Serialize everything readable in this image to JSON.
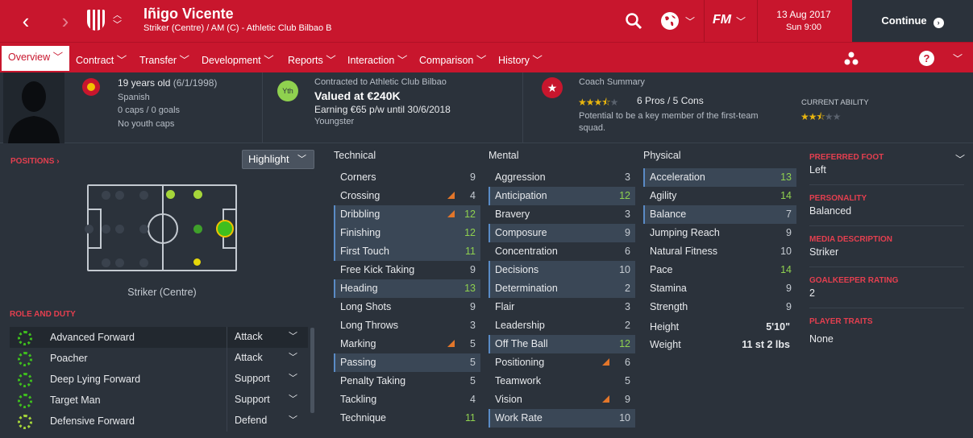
{
  "header": {
    "player_name": "Iñigo Vicente",
    "subtitle": "Striker (Centre) / AM (C) - Athletic Club Bilbao B",
    "logo": "FM",
    "date": "13 Aug 2017",
    "time": "Sun 9:00",
    "continue_label": "Continue"
  },
  "tabs": [
    "Overview",
    "Contract",
    "Transfer",
    "Development",
    "Reports",
    "Interaction",
    "Comparison",
    "History"
  ],
  "bio": {
    "age": "19 years old",
    "dob": "(6/1/1998)",
    "nationality": "Spanish",
    "caps": "0 caps / 0 goals",
    "youth_caps": "No youth caps"
  },
  "contract": {
    "badge": "Yth",
    "contracted_to": "Contracted to Athletic Club Bilbao",
    "value": "Valued at €240K",
    "earning": "Earning €65 p/w until 30/6/2018",
    "status": "Youngster"
  },
  "coach": {
    "title": "Coach Summary",
    "stars": 3.5,
    "pros_cons": "6 Pros / 5 Cons",
    "summary": "Potential to be a key member of the first-team squad.",
    "current_ability_label": "CURRENT ABILITY",
    "current_ability_stars": 2.5
  },
  "positions": {
    "label": "POSITIONS",
    "highlight_label": "Highlight",
    "position_name": "Striker (Centre)",
    "role_duty_label": "ROLE AND DUTY",
    "roles": [
      {
        "name": "Advanced Forward",
        "duty": "Attack"
      },
      {
        "name": "Poacher",
        "duty": "Attack"
      },
      {
        "name": "Deep Lying Forward",
        "duty": "Support"
      },
      {
        "name": "Target Man",
        "duty": "Support"
      },
      {
        "name": "Defensive Forward",
        "duty": "Defend"
      }
    ]
  },
  "technical": {
    "title": "Technical",
    "attrs": [
      {
        "name": "Corners",
        "value": 9
      },
      {
        "name": "Crossing",
        "value": 4,
        "trend": "down"
      },
      {
        "name": "Dribbling",
        "value": 12,
        "trend": "down",
        "highlight": true
      },
      {
        "name": "Finishing",
        "value": 12,
        "highlight": true
      },
      {
        "name": "First Touch",
        "value": 11,
        "highlight": true
      },
      {
        "name": "Free Kick Taking",
        "value": 9
      },
      {
        "name": "Heading",
        "value": 13,
        "highlight": true
      },
      {
        "name": "Long Shots",
        "value": 9
      },
      {
        "name": "Long Throws",
        "value": 3
      },
      {
        "name": "Marking",
        "value": 5,
        "trend": "down"
      },
      {
        "name": "Passing",
        "value": 5,
        "highlight": true
      },
      {
        "name": "Penalty Taking",
        "value": 5
      },
      {
        "name": "Tackling",
        "value": 4
      },
      {
        "name": "Technique",
        "value": 11
      }
    ]
  },
  "mental": {
    "title": "Mental",
    "attrs": [
      {
        "name": "Aggression",
        "value": 3
      },
      {
        "name": "Anticipation",
        "value": 12,
        "highlight": true
      },
      {
        "name": "Bravery",
        "value": 3
      },
      {
        "name": "Composure",
        "value": 9,
        "highlight": true
      },
      {
        "name": "Concentration",
        "value": 6
      },
      {
        "name": "Decisions",
        "value": 10,
        "highlight": true
      },
      {
        "name": "Determination",
        "value": 2,
        "highlight": true
      },
      {
        "name": "Flair",
        "value": 3
      },
      {
        "name": "Leadership",
        "value": 2
      },
      {
        "name": "Off The Ball",
        "value": 12,
        "highlight": true
      },
      {
        "name": "Positioning",
        "value": 6,
        "trend": "down"
      },
      {
        "name": "Teamwork",
        "value": 5
      },
      {
        "name": "Vision",
        "value": 9,
        "trend": "down"
      },
      {
        "name": "Work Rate",
        "value": 10,
        "highlight": true
      }
    ]
  },
  "physical": {
    "title": "Physical",
    "attrs": [
      {
        "name": "Acceleration",
        "value": 13,
        "highlight": true
      },
      {
        "name": "Agility",
        "value": 14
      },
      {
        "name": "Balance",
        "value": 7,
        "highlight": true
      },
      {
        "name": "Jumping Reach",
        "value": 9
      },
      {
        "name": "Natural Fitness",
        "value": 10
      },
      {
        "name": "Pace",
        "value": 14
      },
      {
        "name": "Stamina",
        "value": 9
      },
      {
        "name": "Strength",
        "value": 9
      }
    ],
    "height_label": "Height",
    "height": "5'10\"",
    "weight_label": "Weight",
    "weight": "11 st 2 lbs"
  },
  "sidebar": {
    "preferred_foot_label": "PREFERRED FOOT",
    "preferred_foot": "Left",
    "personality_label": "PERSONALITY",
    "personality": "Balanced",
    "media_label": "MEDIA DESCRIPTION",
    "media": "Striker",
    "gk_label": "GOALKEEPER RATING",
    "gk": "2",
    "traits_label": "PLAYER TRAITS",
    "traits": "None"
  },
  "colors": {
    "brand": "#c8162d",
    "good": "#8fd14f",
    "trend": "#e3762a"
  }
}
